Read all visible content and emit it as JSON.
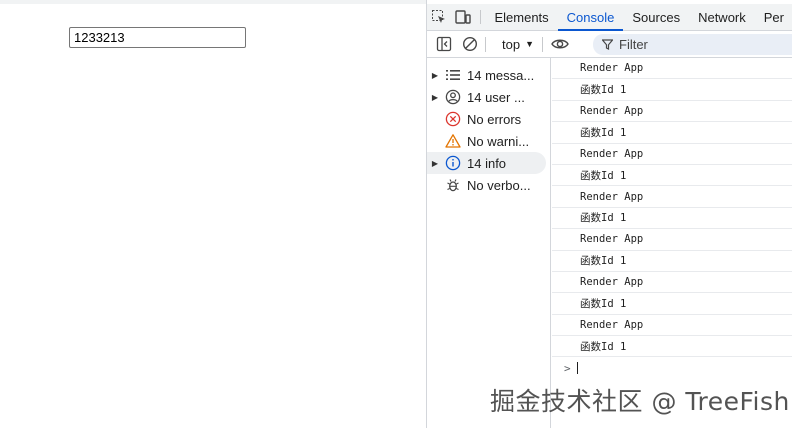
{
  "page": {
    "input_value": "1233213"
  },
  "devtools": {
    "tabs": [
      {
        "label": "Elements"
      },
      {
        "label": "Console"
      },
      {
        "label": "Sources"
      },
      {
        "label": "Network"
      },
      {
        "label": "Per"
      }
    ],
    "active_tab": "Console",
    "toolbar": {
      "context": "top",
      "filter_placeholder": "Filter"
    },
    "sidebar": {
      "items": [
        {
          "label": "14 messa...",
          "icon": "list-icon",
          "expandable": true
        },
        {
          "label": "14 user ...",
          "icon": "user-icon",
          "expandable": true
        },
        {
          "label": "No errors",
          "icon": "error-icon",
          "expandable": false
        },
        {
          "label": "No warni...",
          "icon": "warning-icon",
          "expandable": false
        },
        {
          "label": "14 info",
          "icon": "info-icon",
          "expandable": true,
          "selected": true
        },
        {
          "label": "No verbo...",
          "icon": "bug-icon",
          "expandable": false
        }
      ]
    },
    "console": {
      "messages": [
        "Render App",
        "函数Id 1",
        "Render App",
        "函数Id 1",
        "Render App",
        "函数Id 1",
        "Render App",
        "函数Id 1",
        "Render App",
        "函数Id 1",
        "Render App",
        "函数Id 1",
        "Render App",
        "函数Id 1"
      ]
    }
  },
  "watermark": "掘金技术社区 @ TreeFish",
  "colors": {
    "accent": "#0b57d0",
    "error": "#dc362e",
    "warning": "#e37400",
    "info": "#0b57d0"
  }
}
